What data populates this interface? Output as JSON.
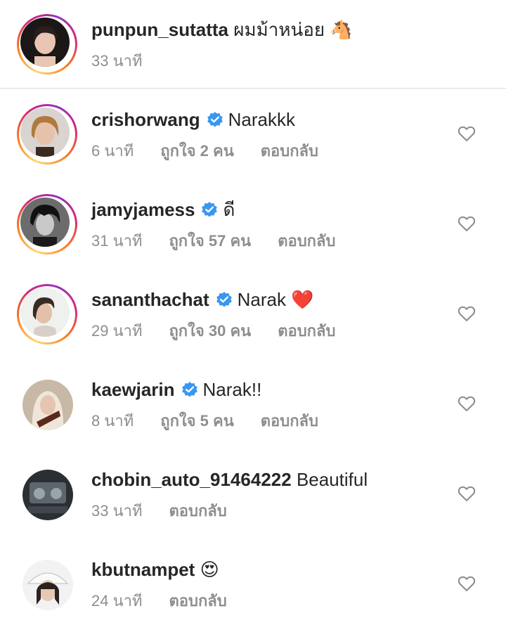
{
  "caption": {
    "username": "punpun_sutatta",
    "text": "ผมม้าหน่อย",
    "emoji": "🐴",
    "time": "33 นาที"
  },
  "comments": [
    {
      "username": "crishorwang",
      "verified": true,
      "text": "Narakkk",
      "emoji": "",
      "time": "6 นาที",
      "likes": "ถูกใจ 2 คน",
      "reply": "ตอบกลับ",
      "ring": true
    },
    {
      "username": "jamyjamess",
      "verified": true,
      "text": "ดี",
      "emoji": "",
      "time": "31 นาที",
      "likes": "ถูกใจ 57 คน",
      "reply": "ตอบกลับ",
      "ring": true
    },
    {
      "username": "sananthachat",
      "verified": true,
      "text": "Narak",
      "emoji": "❤️",
      "time": "29 นาที",
      "likes": "ถูกใจ 30 คน",
      "reply": "ตอบกลับ",
      "ring": true
    },
    {
      "username": "kaewjarin",
      "verified": true,
      "text": "Narak!!",
      "emoji": "",
      "time": "8 นาที",
      "likes": "ถูกใจ 5 คน",
      "reply": "ตอบกลับ",
      "ring": false
    },
    {
      "username": "chobin_auto_91464222",
      "verified": false,
      "text": "Beautiful",
      "emoji": "",
      "time": "33 นาที",
      "likes": "",
      "reply": "ตอบกลับ",
      "ring": false
    },
    {
      "username": "kbutnampet",
      "verified": false,
      "text": "",
      "emoji": "😍",
      "time": "24 นาที",
      "likes": "",
      "reply": "ตอบกลับ",
      "ring": false
    }
  ],
  "icons": {
    "verified": "verified-badge-icon",
    "like": "heart-outline-icon"
  },
  "colors": {
    "verified_blue": "#3897f0",
    "secondary_text": "#8e8e8e",
    "heart_red": "#ed4956"
  }
}
